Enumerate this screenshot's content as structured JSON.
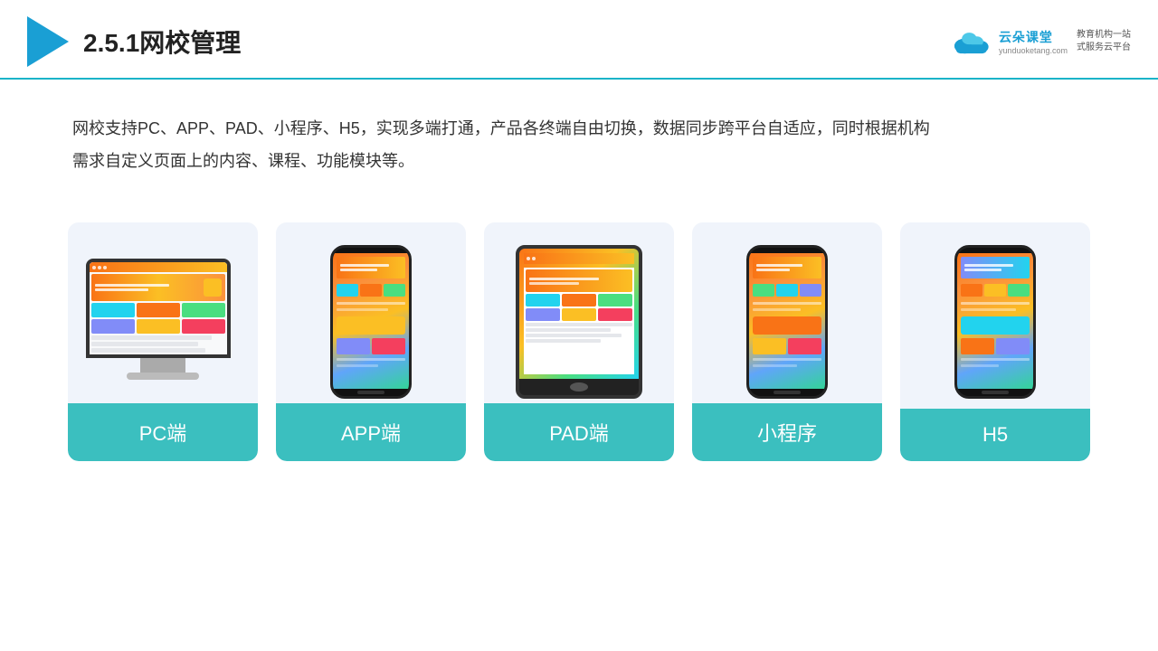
{
  "header": {
    "title": "2.5.1网校管理",
    "brand": {
      "name": "云朵课堂",
      "url": "yunduoketang.com",
      "slogan": "教育机构一站\n式服务云平台"
    }
  },
  "description": {
    "text": "网校支持PC、APP、PAD、小程序、H5，实现多端打通，产品各终端自由切换，数据同步跨平台自适应，同时根据机构\n需求自定义页面上的内容、课程、功能模块等。"
  },
  "cards": [
    {
      "id": "pc",
      "label": "PC端",
      "device": "pc"
    },
    {
      "id": "app",
      "label": "APP端",
      "device": "phone"
    },
    {
      "id": "pad",
      "label": "PAD端",
      "device": "tablet"
    },
    {
      "id": "miniapp",
      "label": "小程序",
      "device": "phone"
    },
    {
      "id": "h5",
      "label": "H5",
      "device": "phone"
    }
  ]
}
